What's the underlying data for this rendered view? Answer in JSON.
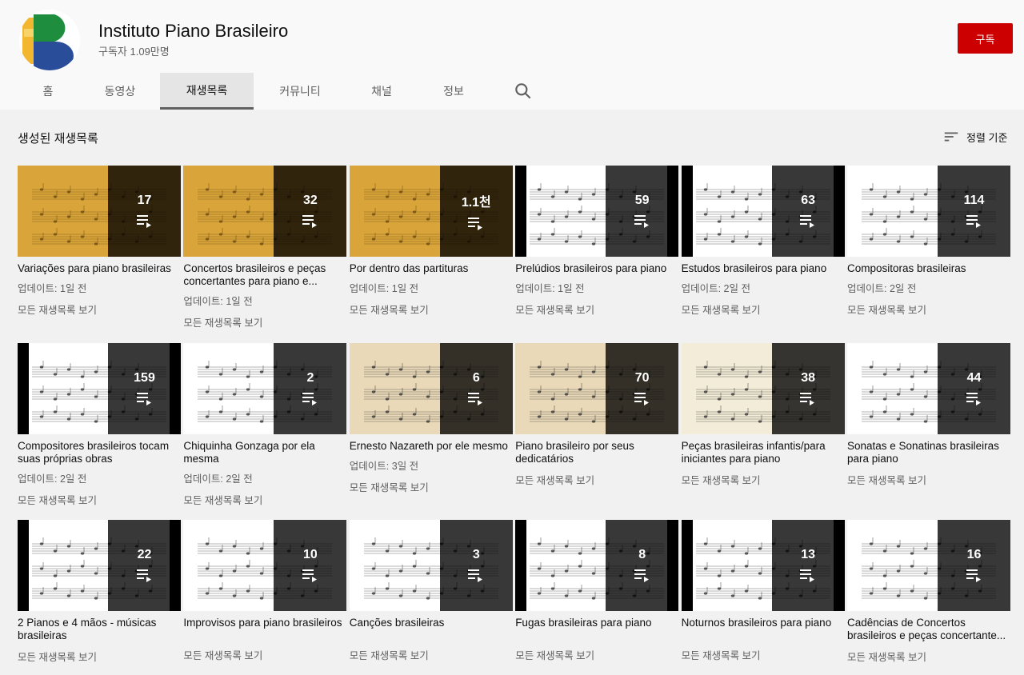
{
  "channel": {
    "name": "Instituto Piano Brasileiro",
    "subscribers": "구독자 1.09만명",
    "subscribe_label": "구독"
  },
  "tabs": [
    {
      "label": "홈"
    },
    {
      "label": "동영상"
    },
    {
      "label": "재생목록",
      "active": true
    },
    {
      "label": "커뮤니티"
    },
    {
      "label": "채널"
    },
    {
      "label": "정보"
    }
  ],
  "search_icon": "search-icon",
  "section": {
    "title": "생성된 재생목록",
    "sort_label": "정렬 기준"
  },
  "view_all_label": "모든 재생목록 보기",
  "playlists": [
    {
      "title": "Variações para piano brasileiras",
      "count": "17",
      "updated": "업데이트: 1일 전",
      "thumb": "yellow"
    },
    {
      "title": "Concertos brasileiros e peças concertantes para piano e...",
      "count": "32",
      "updated": "업데이트: 1일 전",
      "thumb": "yellow"
    },
    {
      "title": "Por dentro das partituras",
      "count": "1.1천",
      "updated": "업데이트: 1일 전",
      "thumb": "yellow"
    },
    {
      "title": "Prelúdios brasileiros para piano",
      "count": "59",
      "updated": "업데이트: 1일 전",
      "thumb": "white"
    },
    {
      "title": "Estudos brasileiros para piano",
      "count": "63",
      "updated": "업데이트: 2일 전",
      "thumb": "white"
    },
    {
      "title": "Compositoras brasileiras",
      "count": "114",
      "updated": "업데이트: 2일 전",
      "thumb": "white"
    },
    {
      "title": "Compositores brasileiros tocam suas próprias obras",
      "count": "159",
      "updated": "업데이트: 2일 전",
      "thumb": "white"
    },
    {
      "title": "Chiquinha Gonzaga por ela mesma",
      "count": "2",
      "updated": "업데이트: 2일 전",
      "thumb": "white"
    },
    {
      "title": "Ernesto Nazareth por ele mesmo",
      "count": "6",
      "updated": "업데이트: 3일 전",
      "thumb": "beige"
    },
    {
      "title": "Piano brasileiro por seus dedicatários",
      "count": "70",
      "updated": "",
      "thumb": "beige"
    },
    {
      "title": "Peças brasileiras infantis/para iniciantes para piano",
      "count": "38",
      "updated": "",
      "thumb": "cream"
    },
    {
      "title": "Sonatas e Sonatinas brasileiras para piano",
      "count": "44",
      "updated": "",
      "thumb": "white"
    },
    {
      "title": "2 Pianos e 4 mãos - músicas brasileiras",
      "count": "22",
      "updated": "",
      "thumb": "white"
    },
    {
      "title": "Improvisos para piano brasileiros",
      "count": "10",
      "updated": "",
      "thumb": "white"
    },
    {
      "title": "Canções brasileiras",
      "count": "3",
      "updated": "",
      "thumb": "white"
    },
    {
      "title": "Fugas brasileiras para piano",
      "count": "8",
      "updated": "",
      "thumb": "white"
    },
    {
      "title": "Noturnos brasileiros para piano",
      "count": "13",
      "updated": "",
      "thumb": "white"
    },
    {
      "title": "Cadências de Concertos brasileiros e peças concertante...",
      "count": "16",
      "updated": "",
      "thumb": "white"
    }
  ],
  "colors": {
    "subscribe": "#cc0000",
    "thumb_yellow": "#d9a43a",
    "thumb_beige": "#ead9b8",
    "thumb_cream": "#f3ecd8"
  }
}
